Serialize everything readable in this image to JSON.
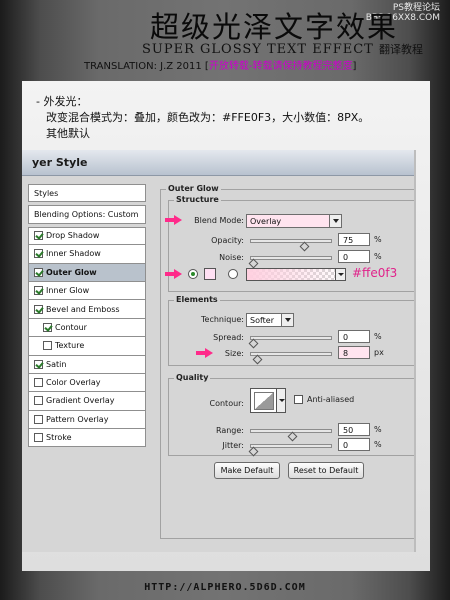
{
  "header": {
    "title_cn": "超级光泽文字效果",
    "subtitle_en": "SUPER GLOSSY TEXT EFFECT",
    "subtitle_cn": "翻译教程",
    "translation_prefix": "TRANSLATION: J.Z  2011 [",
    "translation_note": "开放转载-转载请保持教程完整度",
    "translation_suffix": "]",
    "watermark_line1": "PS教程论坛",
    "watermark_line2": "BBS.16XX8.COM"
  },
  "note": {
    "line1": "- 外发光：",
    "line2": "改变混合模式为：叠加，颜色改为：#FFE0F3，大小数值：8PX。",
    "line3": "其他默认"
  },
  "dialog": {
    "title": "yer Style",
    "sidebar": [
      {
        "label": "Styles",
        "checkbox": false
      },
      {
        "label": "Blending Options: Custom",
        "checkbox": false
      },
      {
        "label": "Drop Shadow",
        "checkbox": true,
        "checked": true
      },
      {
        "label": "Inner Shadow",
        "checkbox": true,
        "checked": true
      },
      {
        "label": "Outer Glow",
        "checkbox": true,
        "checked": true,
        "selected": true
      },
      {
        "label": "Inner Glow",
        "checkbox": true,
        "checked": true
      },
      {
        "label": "Bevel and Emboss",
        "checkbox": true,
        "checked": true
      },
      {
        "label": "Contour",
        "checkbox": true,
        "checked": true,
        "indent": true
      },
      {
        "label": "Texture",
        "checkbox": true,
        "checked": false,
        "indent": true
      },
      {
        "label": "Satin",
        "checkbox": true,
        "checked": true
      },
      {
        "label": "Color Overlay",
        "checkbox": true,
        "checked": false
      },
      {
        "label": "Gradient Overlay",
        "checkbox": true,
        "checked": false
      },
      {
        "label": "Pattern Overlay",
        "checkbox": true,
        "checked": false
      },
      {
        "label": "Stroke",
        "checkbox": true,
        "checked": false
      }
    ],
    "outer_glow_title": "Outer Glow",
    "structure": {
      "title": "Structure",
      "blend_mode_label": "Blend Mode:",
      "blend_mode_value": "Overlay",
      "opacity_label": "Opacity:",
      "opacity_value": "75",
      "opacity_unit": "%",
      "noise_label": "Noise:",
      "noise_value": "0",
      "noise_unit": "%",
      "color_hex_annotation": "#ffe0f3",
      "glow_color": "#ffe0f3"
    },
    "elements": {
      "title": "Elements",
      "technique_label": "Technique:",
      "technique_value": "Softer",
      "spread_label": "Spread:",
      "spread_value": "0",
      "spread_unit": "%",
      "size_label": "Size:",
      "size_value": "8",
      "size_unit": "px"
    },
    "quality": {
      "title": "Quality",
      "contour_label": "Contour:",
      "anti_aliased_label": "Anti-aliased",
      "range_label": "Range:",
      "range_value": "50",
      "range_unit": "%",
      "jitter_label": "Jitter:",
      "jitter_value": "0",
      "jitter_unit": "%"
    },
    "make_default_label": "Make Default",
    "reset_default_label": "Reset to Default"
  },
  "footer": {
    "url": "HTTP://ALPHERO.5D6D.COM"
  },
  "colors": {
    "accent_pink": "#ff2a8a",
    "annotation_pink": "#e0238a",
    "magenta_note": "#cc00cc"
  }
}
